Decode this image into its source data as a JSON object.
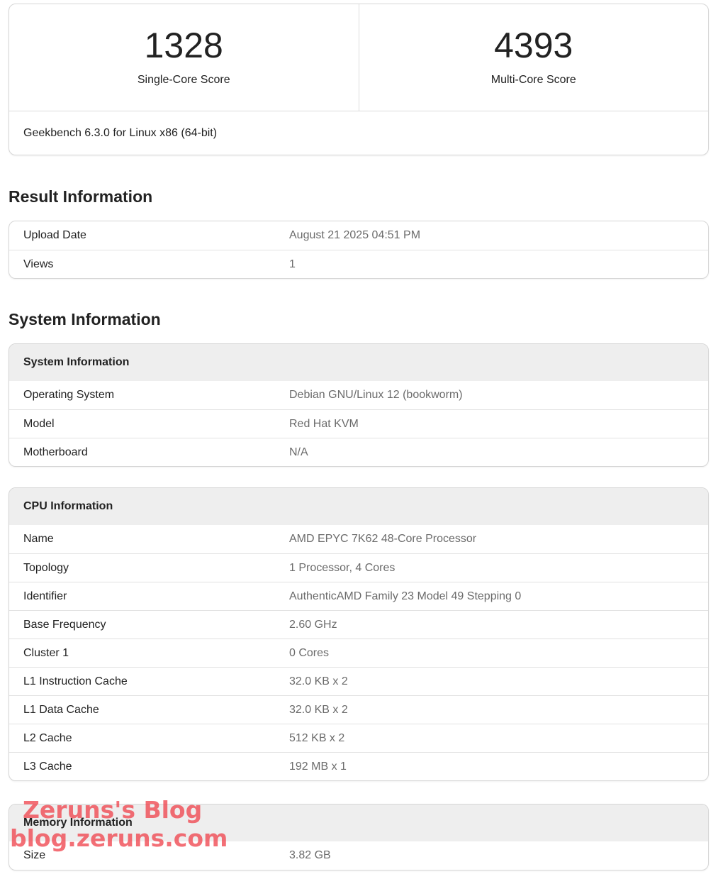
{
  "scores": {
    "single_value": "1328",
    "single_label": "Single-Core Score",
    "multi_value": "4393",
    "multi_label": "Multi-Core Score",
    "version": "Geekbench 6.3.0 for Linux x86 (64-bit)"
  },
  "result_info": {
    "title": "Result Information",
    "rows": [
      {
        "key": "Upload Date",
        "value": "August 21 2025 04:51 PM"
      },
      {
        "key": "Views",
        "value": "1"
      }
    ]
  },
  "system_info": {
    "title": "System Information",
    "system": {
      "header": "System Information",
      "rows": [
        {
          "key": "Operating System",
          "value": "Debian GNU/Linux 12 (bookworm)"
        },
        {
          "key": "Model",
          "value": "Red Hat KVM"
        },
        {
          "key": "Motherboard",
          "value": "N/A"
        }
      ]
    },
    "cpu": {
      "header": "CPU Information",
      "rows": [
        {
          "key": "Name",
          "value": "AMD EPYC 7K62 48-Core Processor"
        },
        {
          "key": "Topology",
          "value": "1 Processor, 4 Cores"
        },
        {
          "key": "Identifier",
          "value": "AuthenticAMD Family 23 Model 49 Stepping 0"
        },
        {
          "key": "Base Frequency",
          "value": "2.60 GHz"
        },
        {
          "key": "Cluster 1",
          "value": "0 Cores"
        },
        {
          "key": "L1 Instruction Cache",
          "value": "32.0 KB x 2"
        },
        {
          "key": "L1 Data Cache",
          "value": "32.0 KB x 2"
        },
        {
          "key": "L2 Cache",
          "value": "512 KB x 2"
        },
        {
          "key": "L3 Cache",
          "value": "192 MB x 1"
        }
      ]
    },
    "memory": {
      "header": "Memory Information",
      "rows": [
        {
          "key": "Size",
          "value": "3.82 GB"
        }
      ]
    }
  },
  "watermark": {
    "line1": "Zeruns's Blog",
    "line2": "blog.zeruns.com"
  }
}
